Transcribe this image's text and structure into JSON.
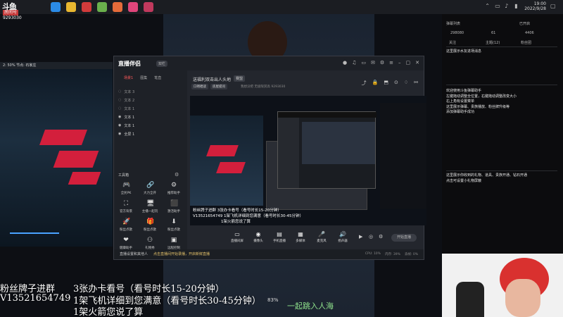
{
  "taskbar": {
    "logo": "斗鱼",
    "room_label": "房间号",
    "room_id": "9293030",
    "clock_time": "19:00",
    "clock_date": "2022/9/28"
  },
  "left_preview": {
    "strip_text": "2: 50%  节点: 石家庄"
  },
  "app": {
    "logo": "直播伴侣",
    "version": "双栏",
    "tabs": [
      "场景1",
      "图集",
      "笔直"
    ],
    "active_tab": 0,
    "layers": [
      "文本 3",
      "文本 2",
      "文本 1",
      "文本 1",
      "文本 1",
      "全屏 1"
    ],
    "tools_label": "工具箱",
    "tools": [
      {
        "icon": "🎮",
        "label": "全民PK"
      },
      {
        "icon": "🔗",
        "label": "大力全开"
      },
      {
        "icon": "⚙",
        "label": "推荐助手"
      },
      {
        "icon": "⛶",
        "label": "官方背景"
      },
      {
        "icon": "🖥",
        "label": "主播一起玩"
      },
      {
        "icon": "⬛",
        "label": "激活助手"
      },
      {
        "icon": "🚀",
        "label": "粉丝点歌"
      },
      {
        "icon": "🎁",
        "label": "粉丝点歌"
      },
      {
        "icon": "⬇",
        "label": "粉丝点歌"
      },
      {
        "icon": "❤",
        "label": "健康助手"
      },
      {
        "icon": "⚇",
        "label": "礼物秀"
      },
      {
        "icon": "▣",
        "label": "远程控制"
      }
    ],
    "room_title": "送福利双击出人头地",
    "room_badge": "赛盟",
    "chips": [
      "口哨唱读",
      "房屋提问"
    ],
    "room_meta": "我想没把 无极限赏高 9293030",
    "caption_lines": [
      "粉丝牌子进群    3张办卡看号（看号时长15-20分钟）",
      "V13521654749  1架飞机详细到您满意（看号时长30-45分钟）",
      "1架火箭您说了算"
    ],
    "bottom_tools": [
      {
        "icon": "▭",
        "label": "直播间屏"
      },
      {
        "icon": "◉",
        "label": "摄像头"
      },
      {
        "icon": "▤",
        "label": "手机直播"
      },
      {
        "icon": "▦",
        "label": "多媒体"
      },
      {
        "icon": "🎤",
        "label": "麦克风"
      },
      {
        "icon": "🔊",
        "label": "扬声器"
      }
    ],
    "start_label": "开始直播",
    "status_text": "直播设置和其他人",
    "status_link": "点击直播间开始录播，开启新鲜直播",
    "status_right": [
      "CPU: 10%",
      "内存: 39%",
      "丢帧: 0%"
    ]
  },
  "right_panel": {
    "top_row": [
      "弹幕列表",
      "已开启"
    ],
    "stats": [
      "298080",
      "61",
      "4406"
    ],
    "stat_labels": [
      "关注",
      "主题(12)",
      "粉丝团"
    ],
    "intro": "这里展示水友进场消息",
    "help_lines": [
      "欢迎使用斗鱼弹幕助手",
      "左键拖动调整全位置，右键拖动调整改变大小",
      "右上角有设置菜单",
      "这里展示弹幕、贵族播放、粉丝牌升级等",
      "添加弹幕助手成功"
    ],
    "gift_lines": [
      "这里展示你收到的礼物、道具、贵族开通、钻石开通",
      "点击可设置小礼物屏蔽"
    ]
  },
  "overlay": {
    "lines": [
      "粉丝牌子进群",
      "3张办卡看号（看号时长15-20分钟）",
      "V13521654749",
      "1架飞机详细到您满意（看号时长30-45分钟）",
      "1架火箭您说了算"
    ],
    "percent": "83%",
    "green_text": "一起跳入人海"
  },
  "colors": {
    "accent": "#ff5a5a",
    "brand_red": "#d31f3c",
    "link": "#e6c36b"
  }
}
